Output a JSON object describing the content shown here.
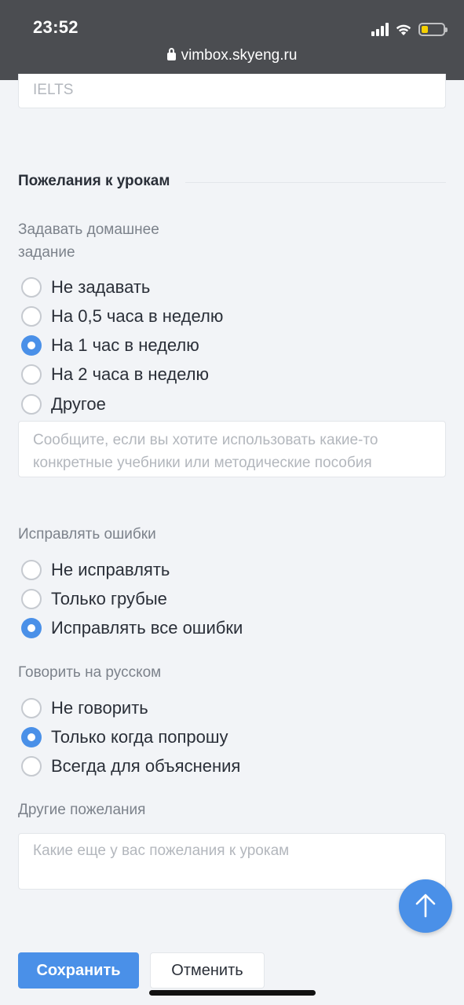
{
  "status_bar": {
    "time": "23:52",
    "url": "vimbox.skyeng.ru"
  },
  "top_field": {
    "value": "IELTS"
  },
  "section": {
    "title": "Пожелания к урокам"
  },
  "homework": {
    "label_line1": "Задавать домашнее",
    "label_line2": "задание",
    "options": [
      "Не задавать",
      "На 0,5 часа в неделю",
      "На 1 час в неделю",
      "На 2 часа в неделю",
      "Другое"
    ],
    "selected": "На 1 час в неделю",
    "note_placeholder_line1": "Сообщите, если вы хотите использовать какие-то",
    "note_placeholder_line2": "конкретные учебники или методические пособия"
  },
  "corrections": {
    "label": "Исправлять ошибки",
    "options": [
      "Не исправлять",
      "Только грубые",
      "Исправлять все ошибки"
    ],
    "selected": "Исправлять все ошибки"
  },
  "russian": {
    "label": "Говорить на русском",
    "options": [
      "Не говорить",
      "Только когда попрошу",
      "Всегда для объяснения"
    ],
    "selected": "Только когда попрошу"
  },
  "other_wishes": {
    "label": "Другие пожелания",
    "placeholder": "Какие еще у вас пожелания к урокам"
  },
  "actions": {
    "save_label": "Сохранить",
    "cancel_label": "Отменить"
  },
  "icons": {
    "lock": "lock-icon",
    "scroll_top": "arrow-up-icon",
    "signal": "cellular-signal-icon",
    "wifi": "wifi-icon",
    "battery": "battery-icon"
  },
  "colors": {
    "accent": "#4a90e8",
    "status_bar": "#4b4d51",
    "battery_level": "#f5d000"
  }
}
